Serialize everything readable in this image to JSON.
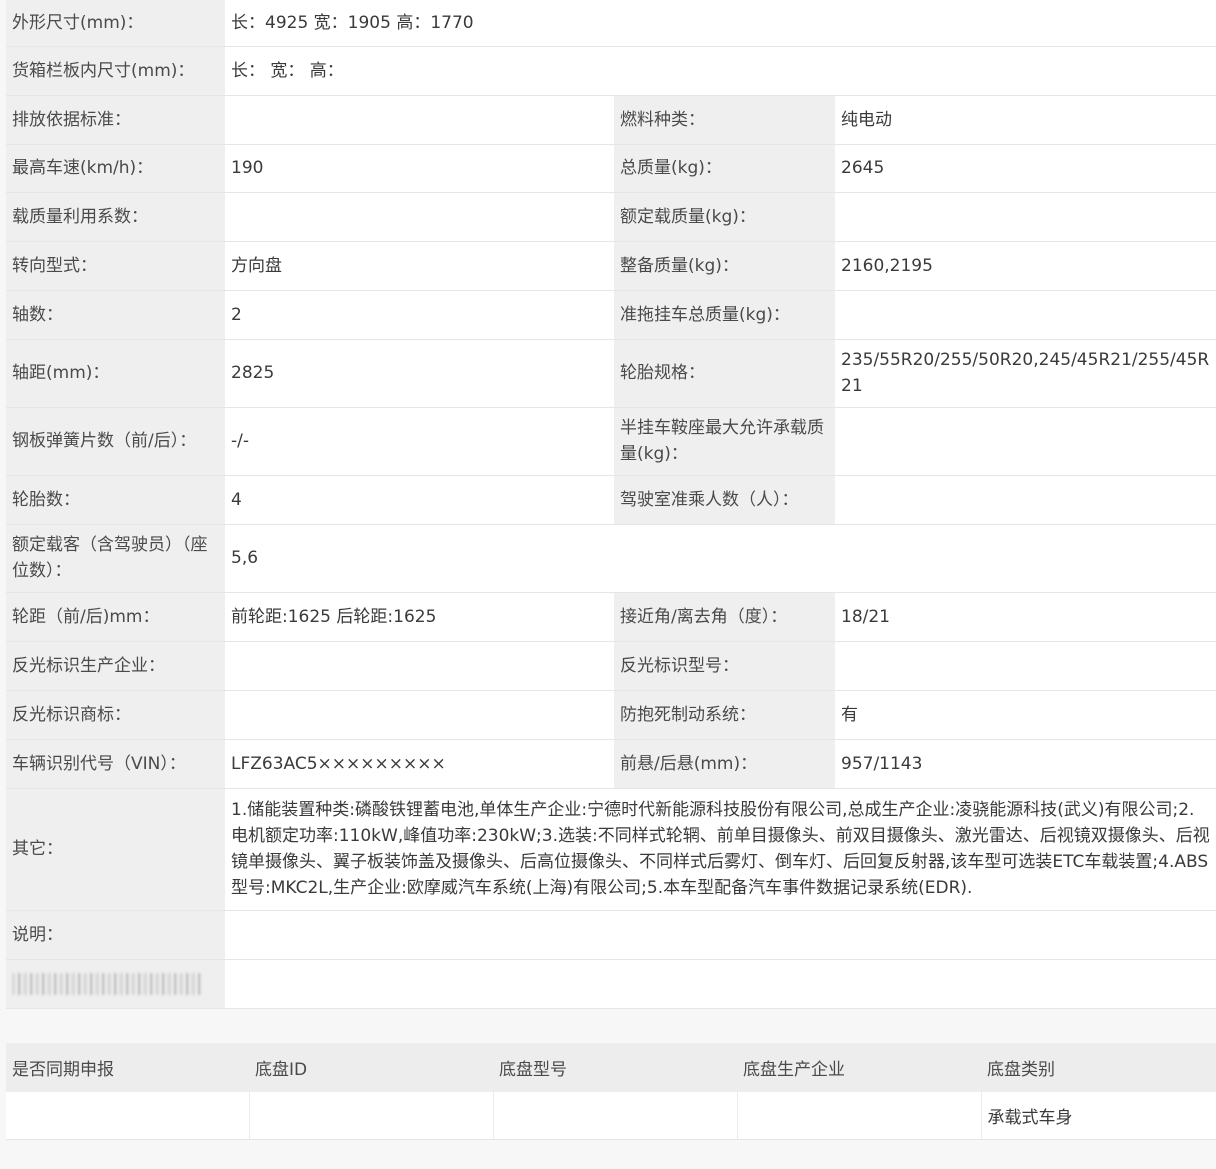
{
  "spec": {
    "dimensions": {
      "label": "外形尺寸(mm)：",
      "value": "长：4925 宽：1905 高：1770"
    },
    "cargo_box": {
      "label": "货箱栏板内尺寸(mm)：",
      "value": "长：  宽：  高："
    },
    "emission": {
      "label": "排放依据标准：",
      "value": ""
    },
    "fuel": {
      "label": "燃料种类：",
      "value": "纯电动"
    },
    "max_speed": {
      "label": "最高车速(km/h)：",
      "value": "190"
    },
    "total_mass": {
      "label": "总质量(kg)：",
      "value": "2645"
    },
    "load_coef": {
      "label": "载质量利用系数：",
      "value": ""
    },
    "rated_load": {
      "label": "额定载质量(kg)：",
      "value": ""
    },
    "steering": {
      "label": "转向型式：",
      "value": "方向盘"
    },
    "curb_mass": {
      "label": "整备质量(kg)：",
      "value": "2160,2195"
    },
    "axles": {
      "label": "轴数：",
      "value": "2"
    },
    "trailer_mass": {
      "label": "准拖挂车总质量(kg)：",
      "value": ""
    },
    "wheelbase": {
      "label": "轴距(mm)：",
      "value": "2825"
    },
    "tire_spec": {
      "label": "轮胎规格：",
      "value": "235/55R20/255/50R20,245/45R21/255/45R21"
    },
    "leaf_spring": {
      "label": "钢板弹簧片数（前/后）：",
      "value": "-/-"
    },
    "saddle_load": {
      "label": "半挂车鞍座最大允许承载质量(kg)：",
      "value": ""
    },
    "tires": {
      "label": "轮胎数：",
      "value": "4"
    },
    "cab_passengers": {
      "label": "驾驶室准乘人数（人）：",
      "value": ""
    },
    "seats": {
      "label": "额定载客（含驾驶员）（座位数）：",
      "value": "5,6"
    },
    "track": {
      "label": "轮距（前/后)mm：",
      "value": "前轮距:1625 后轮距:1625"
    },
    "angles": {
      "label": "接近角/离去角（度）：",
      "value": "18/21"
    },
    "reflector_maker": {
      "label": "反光标识生产企业：",
      "value": ""
    },
    "reflector_model": {
      "label": "反光标识型号：",
      "value": ""
    },
    "reflector_brand": {
      "label": "反光标识商标：",
      "value": ""
    },
    "abs": {
      "label": "防抱死制动系统：",
      "value": "有"
    },
    "vin": {
      "label": "车辆识别代号（VIN）：",
      "value": "LFZ63AC5×××××××××"
    },
    "overhang": {
      "label": "前悬/后悬(mm)：",
      "value": "957/1143"
    },
    "other": {
      "label": "其它：",
      "value": "1.储能装置种类:磷酸铁锂蓄电池,单体生产企业:宁德时代新能源科技股份有限公司,总成生产企业:凌骁能源科技(武义)有限公司;2.电机额定功率:110kW,峰值功率:230kW;3.选装:不同样式轮辋、前单目摄像头、前双目摄像头、激光雷达、后视镜双摄像头、后视镜单摄像头、翼子板装饰盖及摄像头、后高位摄像头、不同样式后雾灯、倒车灯、后回复反射器,该车型可选装ETC车载装置;4.ABS型号:MKC2L,生产企业:欧摩威汽车系统(上海)有限公司;5.本车型配备汽车事件数据记录系统(EDR)."
    },
    "note": {
      "label": "说明：",
      "value": ""
    }
  },
  "chassis": {
    "headers": [
      "是否同期申报",
      "底盘ID",
      "底盘型号",
      "底盘生产企业",
      "底盘类别"
    ],
    "row": [
      "",
      "",
      "",
      "",
      "承载式车身"
    ]
  }
}
